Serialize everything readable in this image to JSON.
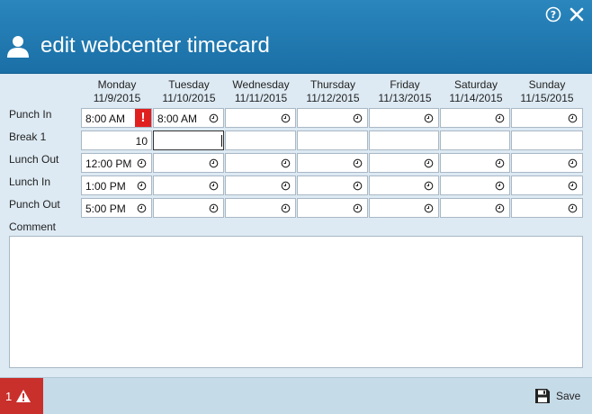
{
  "header": {
    "title": "edit webcenter timecard"
  },
  "days": [
    {
      "name": "Monday",
      "date": "11/9/2015"
    },
    {
      "name": "Tuesday",
      "date": "11/10/2015"
    },
    {
      "name": "Wednesday",
      "date": "11/11/2015"
    },
    {
      "name": "Thursday",
      "date": "11/12/2015"
    },
    {
      "name": "Friday",
      "date": "11/13/2015"
    },
    {
      "name": "Saturday",
      "date": "11/14/2015"
    },
    {
      "name": "Sunday",
      "date": "11/15/2015"
    }
  ],
  "rows": {
    "punch_in": {
      "label": "Punch In",
      "values": [
        "8:00 AM",
        "8:00 AM",
        "",
        "",
        "",
        "",
        ""
      ]
    },
    "break_1": {
      "label": "Break 1",
      "values": [
        "10",
        "",
        "",
        "",
        "",
        "",
        ""
      ]
    },
    "lunch_out": {
      "label": "Lunch Out",
      "values": [
        "12:00 PM",
        "",
        "",
        "",
        "",
        "",
        ""
      ]
    },
    "lunch_in": {
      "label": "Lunch In",
      "values": [
        "1:00 PM",
        "",
        "",
        "",
        "",
        "",
        ""
      ]
    },
    "punch_out": {
      "label": "Punch Out",
      "values": [
        "5:00 PM",
        "",
        "",
        "",
        "",
        "",
        ""
      ]
    }
  },
  "error_marker": "!",
  "comment": {
    "label": "Comment",
    "value": ""
  },
  "footer": {
    "alert_count": "1",
    "save_label": "Save"
  },
  "colors": {
    "header": "#1a6fa6",
    "alert": "#c9302c",
    "error": "#e0201f"
  }
}
